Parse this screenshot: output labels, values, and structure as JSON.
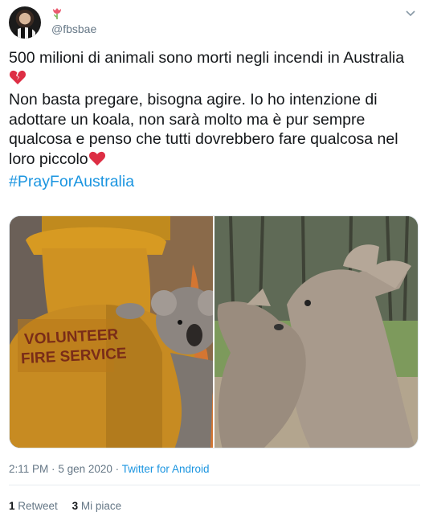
{
  "author": {
    "handle": "@fbsbae",
    "badge_icon": "tulip-icon"
  },
  "tweet": {
    "lines": [
      "500 milioni di animali sono morti negli incendi in Australia",
      "Non basta pregare, bisogna agire. Io ho intenzione di adottare un koala, non sarà molto ma è pur sempre qualcosa e penso che tutti dovrebbero fare qualcosa nel loro piccolo"
    ],
    "hashtag": "#PrayForAustralia",
    "emoji_1": "broken-heart-icon",
    "emoji_2": "red-heart-icon"
  },
  "media": {
    "left_photo_text": [
      "VOLUNTEER",
      "FIRE SERVICE"
    ]
  },
  "meta": {
    "time": "2:11 PM",
    "separator": "·",
    "date": "5 gen 2020",
    "source": "Twitter for Android"
  },
  "stats": {
    "retweets_count": "1",
    "retweets_label": "Retweet",
    "likes_count": "3",
    "likes_label": "Mi piace"
  },
  "colors": {
    "link": "#1b95e0",
    "muted": "#657786",
    "text": "#14171a",
    "heart": "#e0245e"
  }
}
